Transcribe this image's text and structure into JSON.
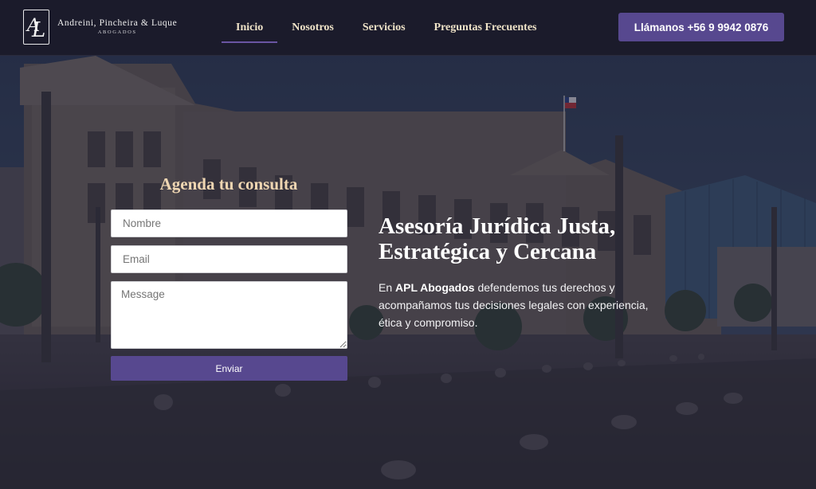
{
  "logo": {
    "name": "Andreini, Pincheira & Luque",
    "subtitle": "ABOGADOS"
  },
  "nav": {
    "items": [
      {
        "label": "Inicio",
        "active": true
      },
      {
        "label": "Nosotros",
        "active": false
      },
      {
        "label": "Servicios",
        "active": false
      },
      {
        "label": "Preguntas Frecuentes",
        "active": false
      }
    ],
    "call_label": "Llámanos +56 9 9942 0876"
  },
  "form": {
    "title": "Agenda tu consulta",
    "name_placeholder": "Nombre",
    "email_placeholder": "Email",
    "message_placeholder": "Message",
    "submit_label": "Enviar"
  },
  "hero": {
    "title_line1": "Asesoría Jurídica Justa,",
    "title_line2": "Estratégica y Cercana",
    "desc_prefix": "En ",
    "desc_brand": "APL Abogados",
    "desc_rest": " defendemos tus derechos y acompañamos tus decisiones legales con experiencia, ética y compromiso."
  },
  "colors": {
    "navbar_bg": "#1b1b2b",
    "accent": "#57488f",
    "nav_text": "#efe3c8",
    "form_title": "#efd6b2"
  }
}
